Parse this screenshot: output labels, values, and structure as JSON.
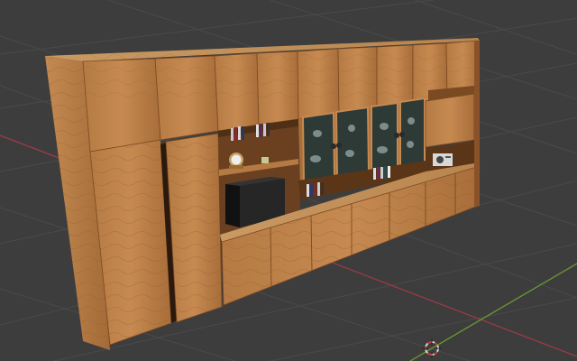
{
  "viewport": {
    "background": "#3d3d3d",
    "grid_color": "#4a4a4a",
    "x_axis_color": "#9a3b45",
    "y_axis_color": "#6b9a32"
  },
  "scene": {
    "object": "wall-unit-cabinet",
    "wood_light": "#b9804a",
    "wood_mid": "#a56a36",
    "wood_dark": "#7c4a22",
    "interior": "#6a4020",
    "glass": "#2d3a36"
  },
  "cursor_3d": {
    "icon": "3d-cursor-icon",
    "ring_color_a": "#d0d0d0",
    "ring_color_b": "#c23a3a"
  }
}
